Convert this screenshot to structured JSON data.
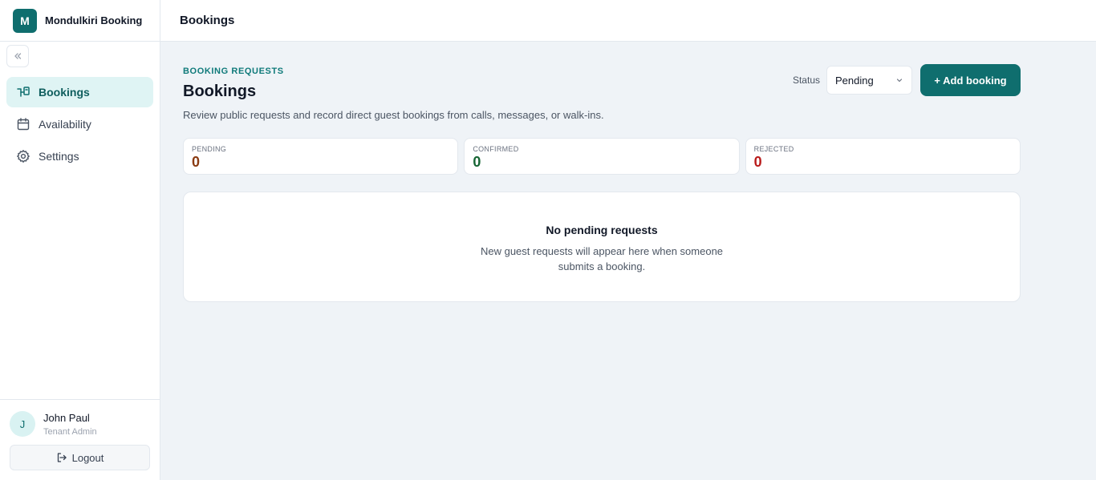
{
  "brand": {
    "logo_letter": "M",
    "name": "Mondulkiri Booking"
  },
  "topbar": {
    "title": "Bookings"
  },
  "sidebar": {
    "items": [
      {
        "label": "Bookings",
        "icon": "bookings-icon",
        "active": true
      },
      {
        "label": "Availability",
        "icon": "calendar-icon",
        "active": false
      },
      {
        "label": "Settings",
        "icon": "gear-icon",
        "active": false
      }
    ]
  },
  "user": {
    "initial": "J",
    "name": "John Paul",
    "role": "Tenant Admin",
    "logout_label": "Logout"
  },
  "page": {
    "eyebrow": "BOOKING REQUESTS",
    "title": "Bookings",
    "description": "Review public requests and record direct guest bookings from calls, messages, or walk-ins."
  },
  "filters": {
    "status_label": "Status",
    "status_value": "Pending"
  },
  "actions": {
    "add_booking_label": "+ Add booking"
  },
  "stats": [
    {
      "label": "PENDING",
      "value": "0",
      "color": "#8a3b12"
    },
    {
      "label": "CONFIRMED",
      "value": "0",
      "color": "#166534"
    },
    {
      "label": "REJECTED",
      "value": "0",
      "color": "#b91c1c"
    }
  ],
  "empty_state": {
    "title": "No pending requests",
    "description": "New guest requests will appear here when someone submits a booking."
  },
  "colors": {
    "accent": "#0f6e6e",
    "active_bg": "#dff4f4",
    "page_bg": "#eff3f7"
  }
}
